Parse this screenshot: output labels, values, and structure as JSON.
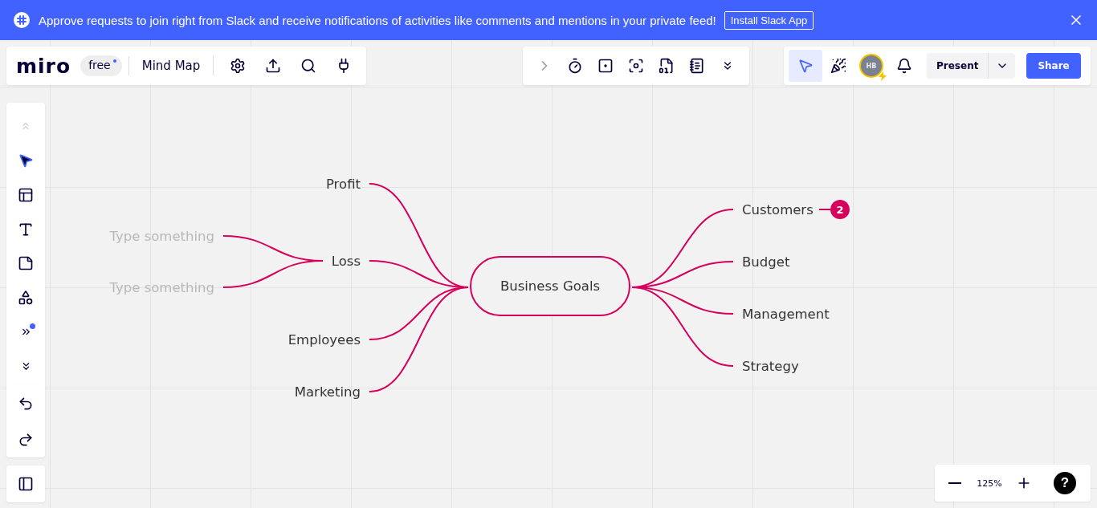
{
  "banner": {
    "message": "Approve requests to join right from Slack and receive notifications of activities like comments and mentions in your private feed!",
    "button": "Install Slack App"
  },
  "board_bar": {
    "logo": "miro",
    "plan": "free",
    "plan_dot": true,
    "title": "Mind Map"
  },
  "collab_bar": {
    "tools": [
      {
        "selected": false
      },
      {
        "selected": false
      },
      {
        "selected": false
      },
      {
        "selected": false
      },
      {
        "selected": false
      },
      {
        "selected": false
      },
      {
        "selected": false
      }
    ]
  },
  "share_bar": {
    "cursor_tool_selected": true,
    "avatar": "HB",
    "present": "Present",
    "share": "Share"
  },
  "left_toolbar": {
    "tools": [
      {
        "selected": false
      },
      {
        "selected": true
      },
      {
        "selected": false
      },
      {
        "selected": false
      },
      {
        "selected": false
      },
      {
        "selected": false
      },
      {
        "selected": false,
        "dot": true
      },
      {
        "selected": false
      }
    ]
  },
  "mind_map": {
    "root": "Business Goals",
    "left": [
      {
        "label": "Profit"
      },
      {
        "label": "Loss",
        "children": [
          {
            "placeholder": "Type something"
          },
          {
            "placeholder": "Type something"
          }
        ]
      },
      {
        "label": "Employees"
      },
      {
        "label": "Marketing"
      }
    ],
    "right": [
      {
        "label": "Customers",
        "badge": "2"
      },
      {
        "label": "Budget"
      },
      {
        "label": "Management"
      },
      {
        "label": "Strategy"
      }
    ]
  },
  "zoom": {
    "level": "125%"
  },
  "help": "?"
}
